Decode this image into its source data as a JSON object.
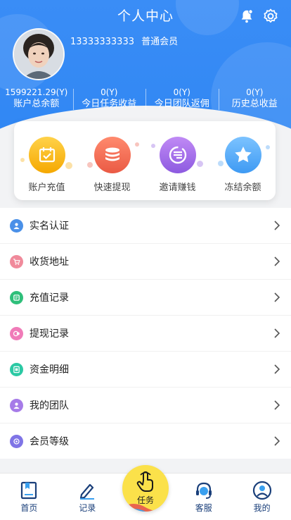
{
  "header": {
    "title": "个人中心",
    "phone": "13333333333",
    "member_level": "普通会员"
  },
  "stats": [
    {
      "value": "1599221.29(Y)",
      "label": "账户总余额"
    },
    {
      "value": "0(Y)",
      "label": "今日任务收益"
    },
    {
      "value": "0(Y)",
      "label": "今日团队返佣"
    },
    {
      "value": "0(Y)",
      "label": "历史总收益"
    }
  ],
  "quick_actions": [
    {
      "label": "账户充值",
      "icon": "calendar-check-icon",
      "color": "#f7b500"
    },
    {
      "label": "快速提现",
      "icon": "coin-stack-icon",
      "color": "#f0654f"
    },
    {
      "label": "邀请赚钱",
      "icon": "share-money-icon",
      "color": "#a36ee8"
    },
    {
      "label": "冻结余额",
      "icon": "star-icon",
      "color": "#3e9af3"
    }
  ],
  "menu": [
    {
      "label": "实名认证",
      "icon": "id-user-icon",
      "color": "#4a90e8"
    },
    {
      "label": "收货地址",
      "icon": "cart-icon",
      "color": "#f08a9b"
    },
    {
      "label": "充值记录",
      "icon": "wallet-icon",
      "color": "#2fbf7a"
    },
    {
      "label": "提现记录",
      "icon": "withdraw-icon",
      "color": "#f07bb8"
    },
    {
      "label": "资金明细",
      "icon": "ledger-icon",
      "color": "#2bc9a4"
    },
    {
      "label": "我的团队",
      "icon": "team-icon",
      "color": "#a67be8"
    },
    {
      "label": "会员等级",
      "icon": "level-icon",
      "color": "#7f74e6"
    }
  ],
  "tabbar": {
    "home": "首页",
    "records": "记录",
    "task": "任务",
    "service": "客服",
    "mine": "我的"
  },
  "colors": {
    "header_blue": "#2f86f3",
    "tab_text": "#1a3f7a",
    "task_yellow": "#fbe14a"
  }
}
